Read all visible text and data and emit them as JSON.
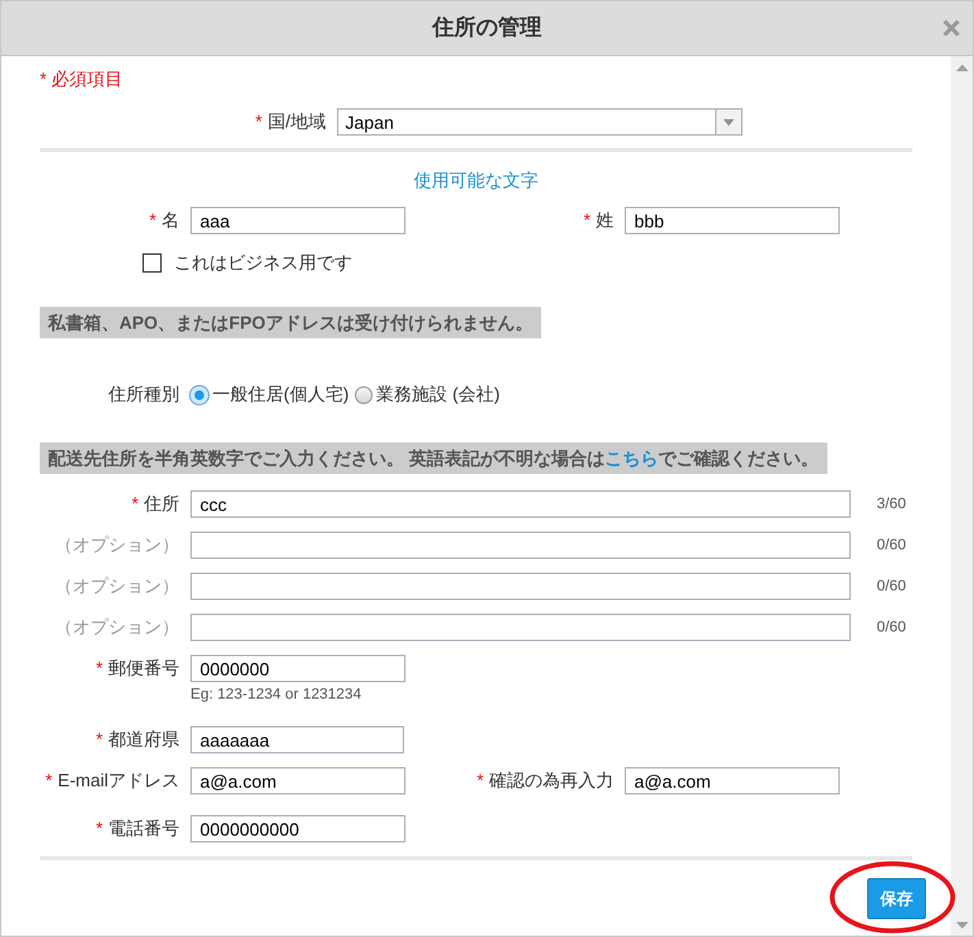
{
  "dialog": {
    "title": "住所の管理"
  },
  "required_note": {
    "mark": "*",
    "text": "必須項目"
  },
  "country": {
    "label": "国/地域",
    "required": true,
    "mark": "*",
    "value": "Japan"
  },
  "charset_link": "使用可能な文字",
  "name_fields": [
    {
      "label": "名",
      "required": true,
      "mark": "*",
      "value": "aaa"
    },
    {
      "label": "姓",
      "required": true,
      "mark": "*",
      "value": "bbb"
    }
  ],
  "business_checkbox": {
    "label": "これはビジネス用です",
    "checked": false
  },
  "notice_1": "私書箱、APO、またはFPOアドレスは受け付けられません。",
  "address_type": {
    "label": "住所種別",
    "options": [
      {
        "label": "一般住居(個人宅)",
        "selected": true
      },
      {
        "label": "業務施設 (会社)",
        "selected": false
      }
    ]
  },
  "notice_2": {
    "text": "配送先住所を半角英数字でご入力ください。 英語表記が不明な場合は",
    "link": "こちら",
    "after": "でご確認ください。"
  },
  "address_lines": [
    {
      "label": "住所",
      "required": true,
      "mark": "*",
      "value": "ccc",
      "counter": "3/60"
    },
    {
      "label": "（オプション）",
      "required": false,
      "counter": "0/60"
    },
    {
      "label": "（オプション）",
      "required": false,
      "counter": "0/60"
    },
    {
      "label": "（オプション）",
      "required": false,
      "counter": "0/60"
    }
  ],
  "postal_code": {
    "label": "郵便番号",
    "required": true,
    "mark": "*",
    "value": "0000000",
    "hint": "Eg: 123-1234 or 1231234"
  },
  "prefecture": {
    "label": "都道府県",
    "required": true,
    "mark": "*",
    "value": "aaaaaaa"
  },
  "email_fields": [
    {
      "label": "E-mailアドレス",
      "required": true,
      "mark": "*",
      "value": "a@a.com"
    },
    {
      "label": "確認の為再入力",
      "required": true,
      "mark": "*",
      "value": "a@a.com"
    }
  ],
  "phone": {
    "label": "電話番号",
    "required": true,
    "mark": "*",
    "value": "0000000000"
  },
  "save_button": "保存",
  "annotations": [
    {
      "kind": "ellipse"
    }
  ]
}
